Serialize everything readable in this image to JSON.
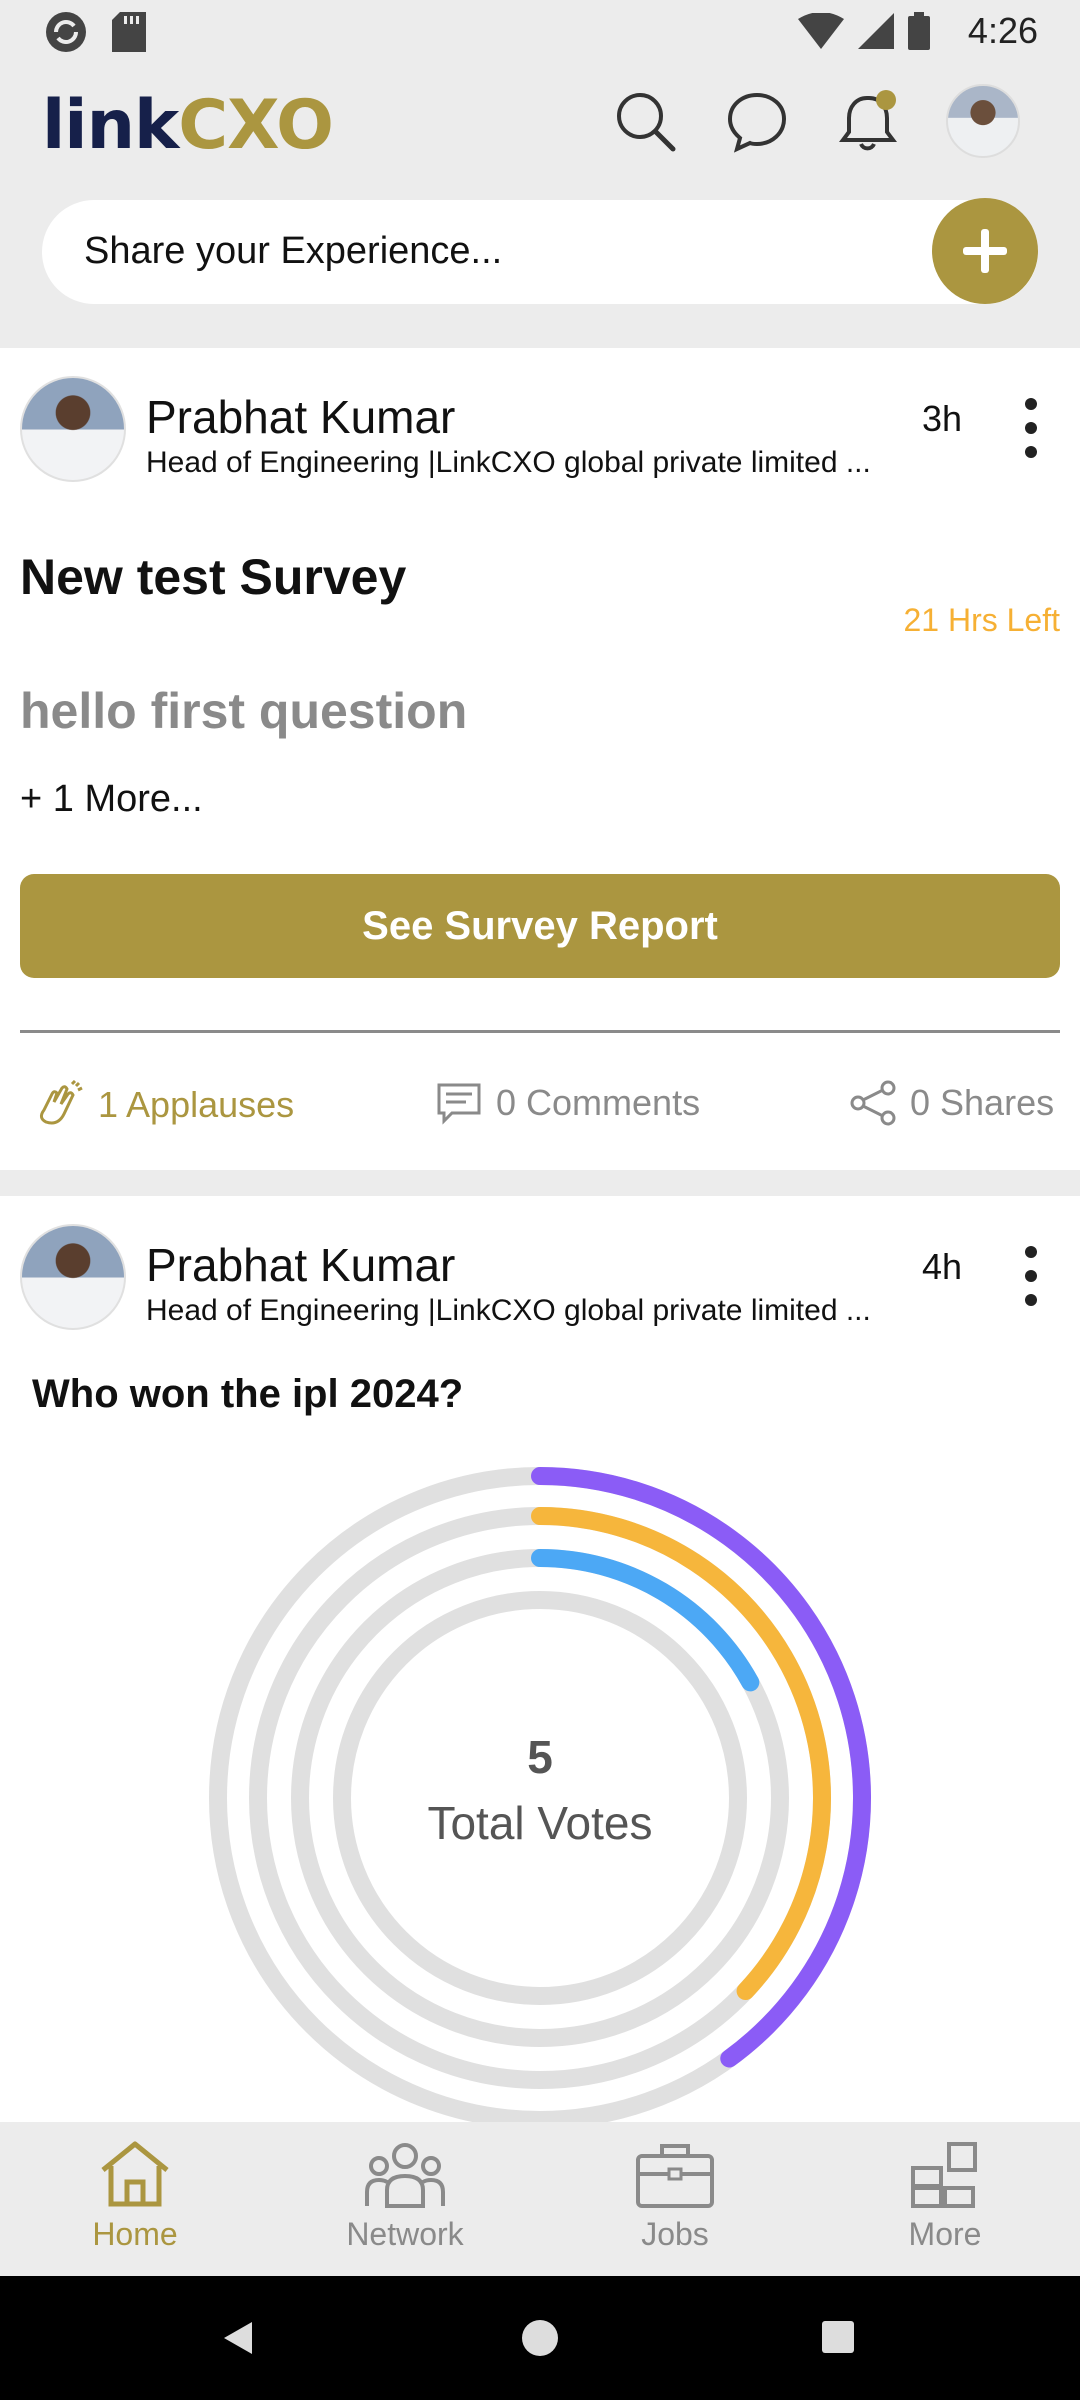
{
  "status_bar": {
    "time": "4:26"
  },
  "header": {
    "logo_link": "link",
    "logo_cxo": "CXO",
    "share_placeholder": "Share your Experience..."
  },
  "posts": [
    {
      "author": "Prabhat Kumar",
      "title": "Head of Engineering |LinkCXO global private limited  ...",
      "time": "3h",
      "survey_title": "New test Survey",
      "time_left": "21 Hrs Left",
      "question": "hello first question",
      "more": "+ 1 More...",
      "button": "See Survey Report",
      "applauses": "1 Applauses",
      "comments": "0 Comments",
      "shares": "0 Shares"
    },
    {
      "author": "Prabhat Kumar",
      "title": "Head of Engineering |LinkCXO global private limited  ...",
      "time": "4h",
      "poll_question": "Who won the ipl 2024?",
      "total_votes": "5",
      "total_votes_label": "Total Votes"
    }
  ],
  "chart_data": {
    "type": "radial-bar",
    "total": 5,
    "series": [
      {
        "value": 0.4,
        "color": "#8b5cf6"
      },
      {
        "value": 0.37,
        "color": "#f6b63c"
      },
      {
        "value": 0.17,
        "color": "#4ca8f5"
      },
      {
        "value": 0,
        "color": "#e0e0e0"
      }
    ]
  },
  "bottom_nav": [
    {
      "label": "Home",
      "icon": "home-icon",
      "active": true
    },
    {
      "label": "Network",
      "icon": "network-icon",
      "active": false
    },
    {
      "label": "Jobs",
      "icon": "briefcase-icon",
      "active": false
    },
    {
      "label": "More",
      "icon": "grid-icon",
      "active": false
    }
  ],
  "colors": {
    "brand": "#ab9640",
    "navy": "#16204a",
    "accent_orange": "#f6b034"
  }
}
